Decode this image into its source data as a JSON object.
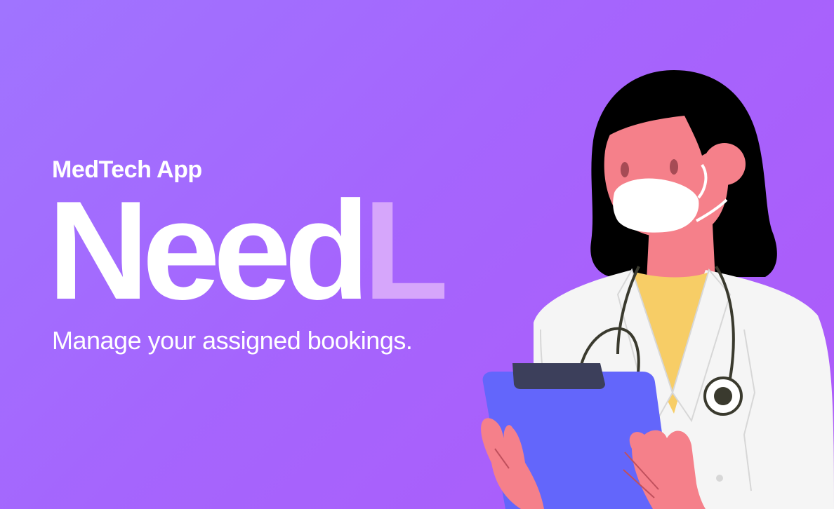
{
  "hero": {
    "kicker": "MedTech App",
    "brand_main": "Need",
    "brand_accent": "L",
    "tagline": "Manage your assigned bookings."
  },
  "illustration": {
    "subject": "doctor-with-clipboard",
    "icons": [
      "face-mask-icon",
      "stethoscope-icon",
      "clipboard-icon"
    ]
  },
  "colors": {
    "background_start": "#a074ff",
    "background_end": "#ad5af9",
    "brand_accent": "#d6a6fb",
    "text": "#ffffff",
    "skin": "#f5808a",
    "hair": "#000000",
    "coat": "#f5f5f5",
    "shirt": "#f7cd66",
    "clipboard": "#6366fb",
    "clip": "#3c3f5b"
  }
}
